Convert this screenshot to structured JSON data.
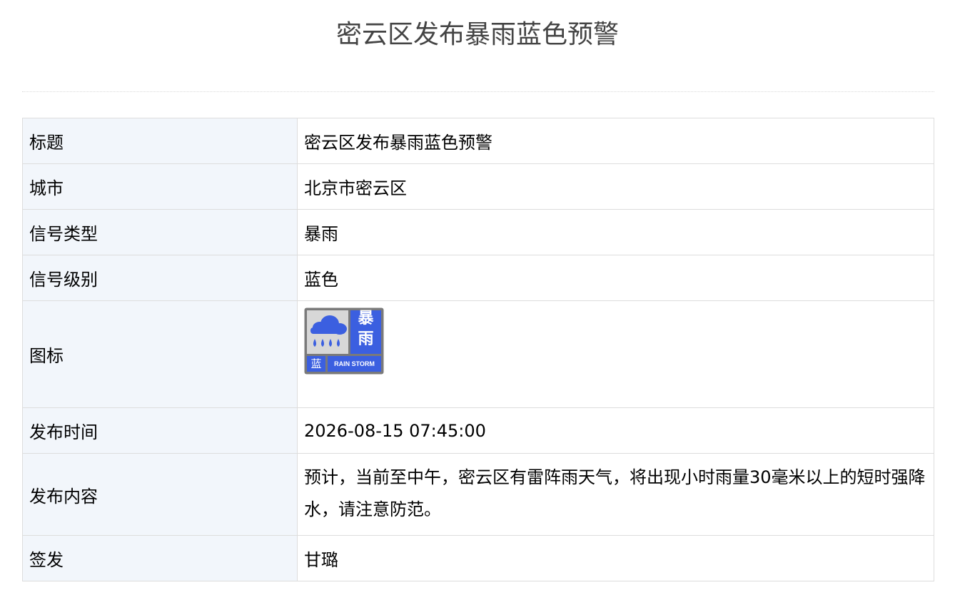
{
  "page": {
    "title": "密云区发布暴雨蓝色预警"
  },
  "table": {
    "rows": [
      {
        "label": "标题",
        "value": "密云区发布暴雨蓝色预警"
      },
      {
        "label": "城市",
        "value": "北京市密云区"
      },
      {
        "label": "信号类型",
        "value": "暴雨"
      },
      {
        "label": "信号级别",
        "value": "蓝色"
      },
      {
        "label": "图标",
        "icon": "rain-storm-blue-warning-icon"
      },
      {
        "label": "发布时间",
        "value": "2026-08-15 07:45:00"
      },
      {
        "label": "发布内容",
        "value": "预计，当前至中午，密云区有雷阵雨天气，将出现小时雨量30毫米以上的短时强降水，请注意防范。"
      },
      {
        "label": "签发",
        "value": "甘璐"
      }
    ]
  },
  "icon": {
    "level_char": "蓝",
    "type_chars": [
      "暴",
      "雨"
    ],
    "english_text": "RAIN STORM"
  },
  "colors": {
    "icon_blue": "#3b5fe0",
    "icon_border": "#7a7a7a",
    "icon_cloud_bg": "#d7d7d7",
    "label_bg": "#f2f6fb",
    "border": "#dddddd",
    "title": "#444444"
  }
}
